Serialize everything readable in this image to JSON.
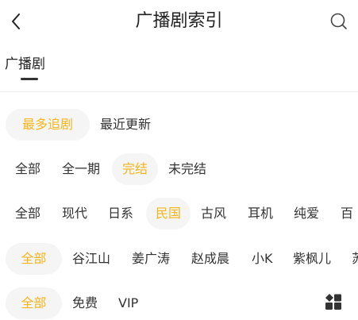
{
  "header": {
    "back_icon": "chevron-left-icon",
    "title": "广播剧索引",
    "search_icon": "search-icon"
  },
  "tabs": [
    {
      "label": "广播剧",
      "active": true
    }
  ],
  "filters": {
    "sort": [
      "最多追剧",
      "最近更新"
    ],
    "status": [
      "全部",
      "全一期",
      "完结",
      "未完结"
    ],
    "genre": [
      "全部",
      "现代",
      "日系",
      "民国",
      "古风",
      "耳机",
      "纯爱",
      "百"
    ],
    "cv": [
      "全部",
      "谷江山",
      "姜广涛",
      "赵成晨",
      "小K",
      "紫枫儿",
      "苏"
    ],
    "price": [
      "全部",
      "免费",
      "VIP"
    ]
  },
  "grid_icon": "grid-icon",
  "colors": {
    "accent": "#f5b51d",
    "chip_bg": "#f5f5f5",
    "text": "#333333"
  }
}
